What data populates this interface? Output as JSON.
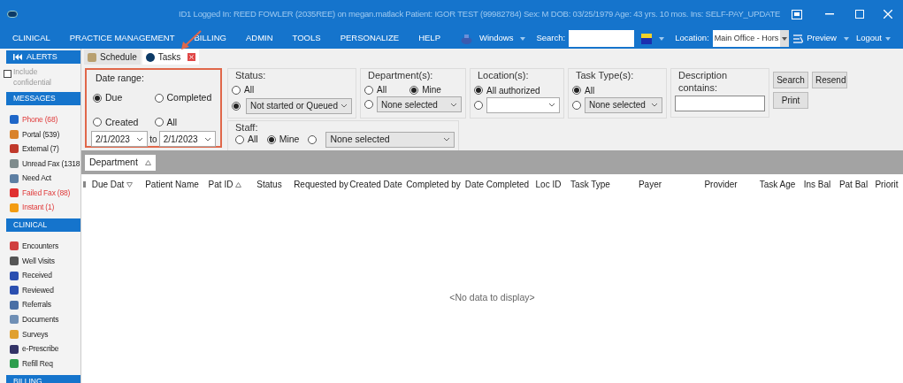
{
  "title_bar": {
    "text": "ID1 Logged In: REED FOWLER (2035REE) on megan.matlack  Patient: IGOR TEST (99982784)  Sex: M  DOB: 03/25/1979  Age: 43 yrs. 10 mos.  Ins: SELF-PAY_UPDATE"
  },
  "menu": [
    {
      "label": "CLINICAL"
    },
    {
      "label": "PRACTICE MANAGEMENT"
    },
    {
      "label": "BILLING"
    },
    {
      "label": "ADMIN"
    },
    {
      "label": "TOOLS"
    },
    {
      "label": "PERSONALIZE"
    },
    {
      "label": "HELP"
    }
  ],
  "toolbar": {
    "windows": "Windows",
    "search_label": "Search:",
    "location_label": "Location:",
    "location_value": "Main Office - Hors",
    "preview": "Preview",
    "logout": "Logout"
  },
  "sidebar": {
    "alerts": "ALERTS",
    "include_confidential": {
      "label": "Include confidential",
      "checked": false
    },
    "sections": [
      {
        "title": "MESSAGES",
        "items": [
          {
            "label": "Phone (68)",
            "alert": true
          },
          {
            "label": "Portal (539)",
            "alert": false
          },
          {
            "label": "External (7)",
            "alert": false
          },
          {
            "label": "Unread Fax (1318",
            "alert": false
          },
          {
            "label": "Need Act",
            "alert": false
          },
          {
            "label": "Failed Fax (88)",
            "alert": true
          },
          {
            "label": "Instant (1)",
            "alert": true
          }
        ]
      },
      {
        "title": "CLINICAL",
        "items": [
          {
            "label": "Encounters",
            "alert": false
          },
          {
            "label": "Well Visits",
            "alert": false
          },
          {
            "label": "Received",
            "alert": false
          },
          {
            "label": "Reviewed",
            "alert": false
          },
          {
            "label": "Referrals",
            "alert": false
          },
          {
            "label": "Documents",
            "alert": false
          },
          {
            "label": "Surveys",
            "alert": false
          },
          {
            "label": "e-Prescribe",
            "alert": false
          },
          {
            "label": "Refill Req",
            "alert": false
          }
        ]
      },
      {
        "title": "BILLING"
      }
    ]
  },
  "tabs": [
    {
      "label": "Schedule",
      "selected": false,
      "closable": false
    },
    {
      "label": "Tasks",
      "selected": true,
      "closable": true
    }
  ],
  "filters": {
    "date_range": {
      "title": "Date range:",
      "options": [
        {
          "label": "Due",
          "selected": true
        },
        {
          "label": "Completed",
          "selected": false
        },
        {
          "label": "Created",
          "selected": false
        },
        {
          "label": "All",
          "selected": false
        }
      ],
      "from": "2/1/2023",
      "to_label": "to",
      "to": "2/1/2023"
    },
    "status": {
      "title": "Status:",
      "all": {
        "label": "All",
        "selected": false
      },
      "pick": {
        "selected": true,
        "value": "Not started or Queued"
      }
    },
    "departments": {
      "title": "Department(s):",
      "all": {
        "label": "All",
        "selected": false
      },
      "mine": {
        "label": "Mine",
        "selected": true
      },
      "pick": {
        "selected": false,
        "value": "None selected"
      }
    },
    "locations": {
      "title": "Location(s):",
      "all": {
        "label": "All authorized",
        "selected": true
      },
      "pick": {
        "selected": false
      }
    },
    "task_types": {
      "title": "Task Type(s):",
      "all": {
        "label": "All",
        "selected": true
      },
      "pick": {
        "selected": false,
        "value": "None selected"
      }
    },
    "description": {
      "title": "Description contains:"
    },
    "buttons": [
      {
        "label": "Search"
      },
      {
        "label": "Resend"
      },
      {
        "label": "Print"
      }
    ],
    "staff": {
      "title": "Staff:",
      "all": {
        "label": "All",
        "selected": false
      },
      "mine": {
        "label": "Mine",
        "selected": true
      },
      "pick": {
        "selected": false,
        "value": "None selected"
      }
    }
  },
  "group_by": {
    "label": "Department",
    "sort_ascending": true
  },
  "columns": [
    {
      "label": "Due Dat",
      "sort_ascending": false
    },
    {
      "label": "Patient Name"
    },
    {
      "label": "Pat ID",
      "sort_ascending": true
    },
    {
      "label": "Status"
    },
    {
      "label": "Requested by"
    },
    {
      "label": "Created Date"
    },
    {
      "label": "Completed by"
    },
    {
      "label": "Date Completed"
    },
    {
      "label": "Loc ID"
    },
    {
      "label": "Task Type"
    },
    {
      "label": "Payer"
    },
    {
      "label": "Provider"
    },
    {
      "label": "Task Age"
    },
    {
      "label": "Ins Bal"
    },
    {
      "label": "Pat Bal"
    },
    {
      "label": "Priorit"
    }
  ],
  "empty_text": "<No data to display>"
}
